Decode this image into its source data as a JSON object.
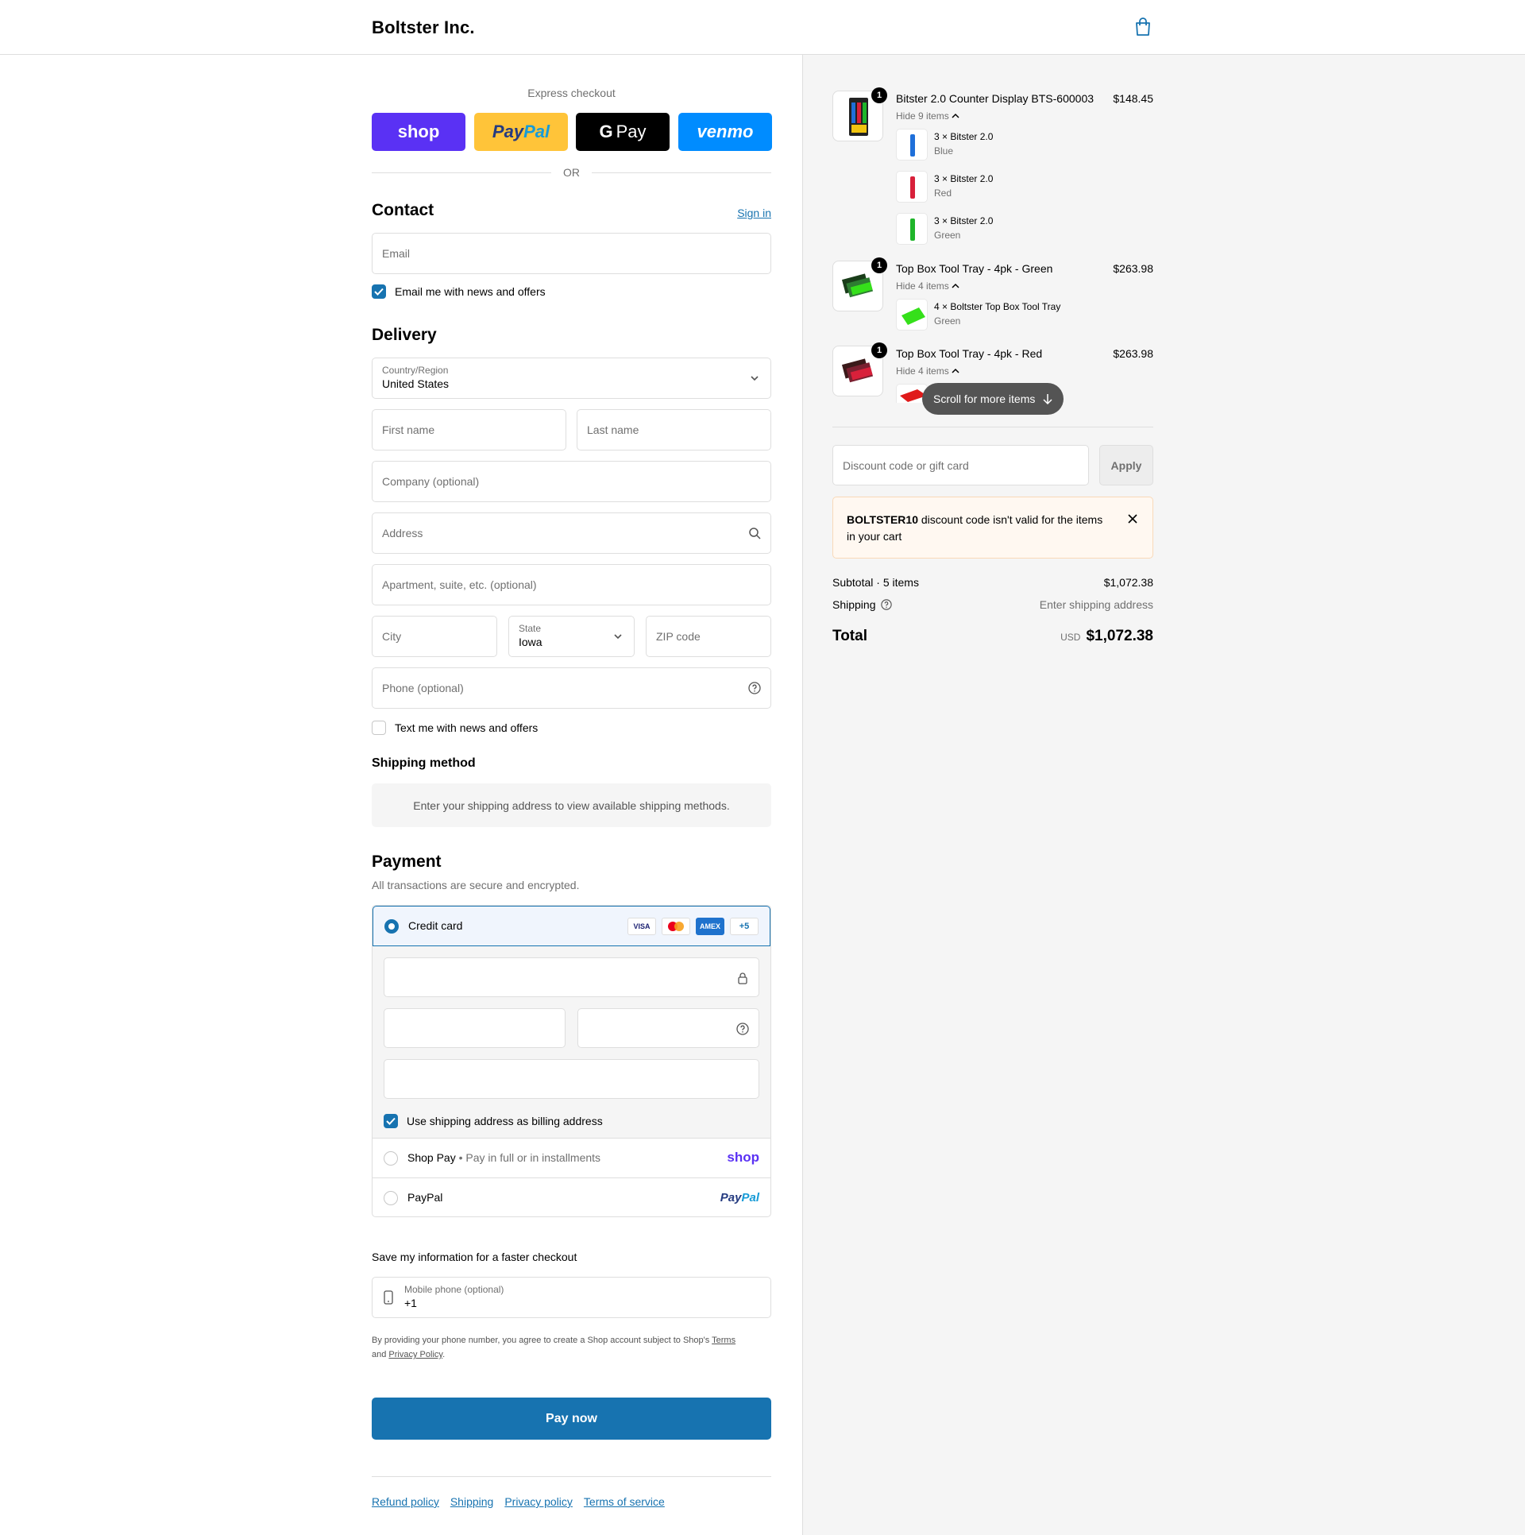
{
  "header": {
    "brand": "Boltster Inc."
  },
  "express": {
    "label": "Express checkout",
    "buttons": {
      "shop": "shop",
      "paypal_1": "Pay",
      "paypal_2": "Pal",
      "gpay_g": "G",
      "gpay": "Pay",
      "venmo": "venmo"
    },
    "or": "OR"
  },
  "contact": {
    "title": "Contact",
    "sign_in": "Sign in",
    "email_placeholder": "Email",
    "email_news": "Email me with news and offers"
  },
  "delivery": {
    "title": "Delivery",
    "country_label": "Country/Region",
    "country_value": "United States",
    "first_name": "First name",
    "last_name": "Last name",
    "company": "Company (optional)",
    "address": "Address",
    "apartment": "Apartment, suite, etc. (optional)",
    "city": "City",
    "state_label": "State",
    "state_value": "Iowa",
    "zip": "ZIP code",
    "phone": "Phone (optional)",
    "text_news": "Text me with news and offers"
  },
  "shipping_method": {
    "title": "Shipping method",
    "message": "Enter your shipping address to view available shipping methods."
  },
  "payment": {
    "title": "Payment",
    "subtitle": "All transactions are secure and encrypted.",
    "credit_card": "Credit card",
    "cards": {
      "visa": "VISA",
      "amex": "AMEX",
      "more": "+5"
    },
    "billing_same": "Use shipping address as billing address",
    "shop_pay": "Shop Pay",
    "shop_pay_sub": "Pay in full or in installments",
    "shop_logo": "shop",
    "paypal": "PayPal",
    "paypal_logo_1": "Pay",
    "paypal_logo_2": "Pal"
  },
  "save_info": {
    "title": "Save my information for a faster checkout",
    "mobile_label": "Mobile phone (optional)",
    "mobile_value": "+1",
    "legal_1": "By providing your phone number, you agree to create a Shop account subject to Shop's ",
    "terms": "Terms",
    "legal_2": "and ",
    "privacy": "Privacy Policy",
    "legal_3": "."
  },
  "pay_now": "Pay now",
  "footer": [
    "Refund policy",
    "Shipping",
    "Privacy policy",
    "Terms of service"
  ],
  "cart": {
    "products": [
      {
        "name": "Bitster 2.0 Counter Display BTS-600003",
        "price": "$148.45",
        "qty": "1",
        "toggle": "Hide 9 items",
        "items": [
          {
            "qty": "3",
            "name": "Bitster 2.0",
            "variant": "Blue",
            "color": "#1e6fd9"
          },
          {
            "qty": "3",
            "name": "Bitster 2.0",
            "variant": "Red",
            "color": "#d8203a"
          },
          {
            "qty": "3",
            "name": "Bitster 2.0",
            "variant": "Green",
            "color": "#1fb52a"
          }
        ]
      },
      {
        "name": "Top Box Tool Tray - 4pk - Green",
        "price": "$263.98",
        "qty": "1",
        "toggle": "Hide 4 items",
        "items": [
          {
            "qty": "4",
            "name": "Boltster Top Box Tool Tray",
            "variant": "Green",
            "color": "#35e01a"
          }
        ]
      },
      {
        "name": "Top Box Tool Tray - 4pk - Red",
        "price": "$263.98",
        "qty": "1",
        "toggle": "Hide 4 items",
        "items": []
      }
    ],
    "times": "×",
    "scroll_pill": "Scroll for more items",
    "discount_placeholder": "Discount code or gift card",
    "apply": "Apply",
    "error_code": "BOLTSTER10",
    "error_msg": " discount code isn't valid for the items in your cart",
    "subtotal_label": "Subtotal · 5 items",
    "subtotal": "$1,072.38",
    "shipping_label": "Shipping",
    "shipping_value": "Enter shipping address",
    "total_label": "Total",
    "currency": "USD",
    "total": "$1,072.38"
  },
  "colors": {
    "accent": "#1773b0",
    "shop": "#5a31f4",
    "paypal": "#ffc439",
    "venmo": "#008cff",
    "error_bg": "#fff8f1"
  }
}
